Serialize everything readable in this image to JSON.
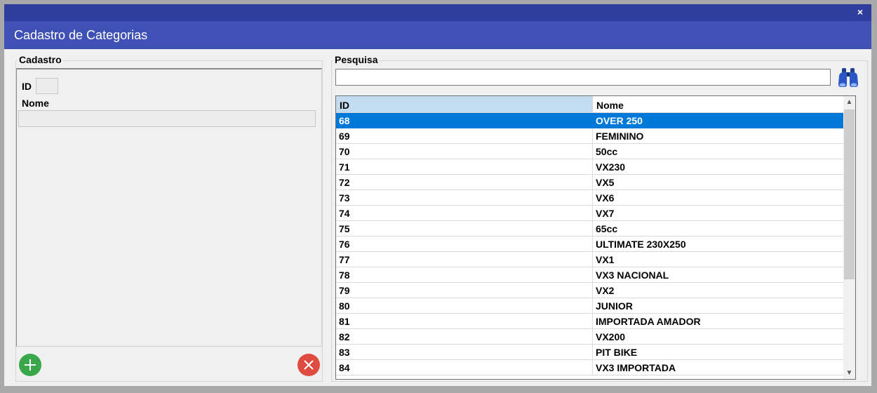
{
  "window": {
    "title": "Cadastro de Categorias",
    "close_glyph": "×"
  },
  "cadastro": {
    "legend": "Cadastro",
    "id_label": "ID",
    "id_value": "",
    "nome_label": "Nome",
    "nome_value": "",
    "add_icon": "plus-icon",
    "delete_icon": "close-circle-icon",
    "add_color": "#3aa84a",
    "delete_color": "#e04b3f"
  },
  "pesquisa": {
    "legend": "Pesquisa",
    "search_value": "",
    "search_icon": "binoculars-icon"
  },
  "grid": {
    "columns": [
      "ID",
      "Nome"
    ],
    "selected_row": 0,
    "selection_color": "#0078d7",
    "rows": [
      {
        "id": "68",
        "nome": "OVER 250"
      },
      {
        "id": "69",
        "nome": "FEMININO"
      },
      {
        "id": "70",
        "nome": "50cc"
      },
      {
        "id": "71",
        "nome": "VX230"
      },
      {
        "id": "72",
        "nome": "VX5"
      },
      {
        "id": "73",
        "nome": "VX6"
      },
      {
        "id": "74",
        "nome": "VX7"
      },
      {
        "id": "75",
        "nome": "65cc"
      },
      {
        "id": "76",
        "nome": "ULTIMATE 230X250"
      },
      {
        "id": "77",
        "nome": "VX1"
      },
      {
        "id": "78",
        "nome": "VX3 NACIONAL"
      },
      {
        "id": "79",
        "nome": "VX2"
      },
      {
        "id": "80",
        "nome": "JUNIOR"
      },
      {
        "id": "81",
        "nome": "IMPORTADA AMADOR"
      },
      {
        "id": "82",
        "nome": "VX200"
      },
      {
        "id": "83",
        "nome": "PIT BIKE"
      },
      {
        "id": "84",
        "nome": "VX3 IMPORTADA"
      }
    ]
  },
  "colors": {
    "titlebar": "#2f3d9e",
    "header": "#3f51b5",
    "header_selected_column": "#c3dcf1"
  }
}
